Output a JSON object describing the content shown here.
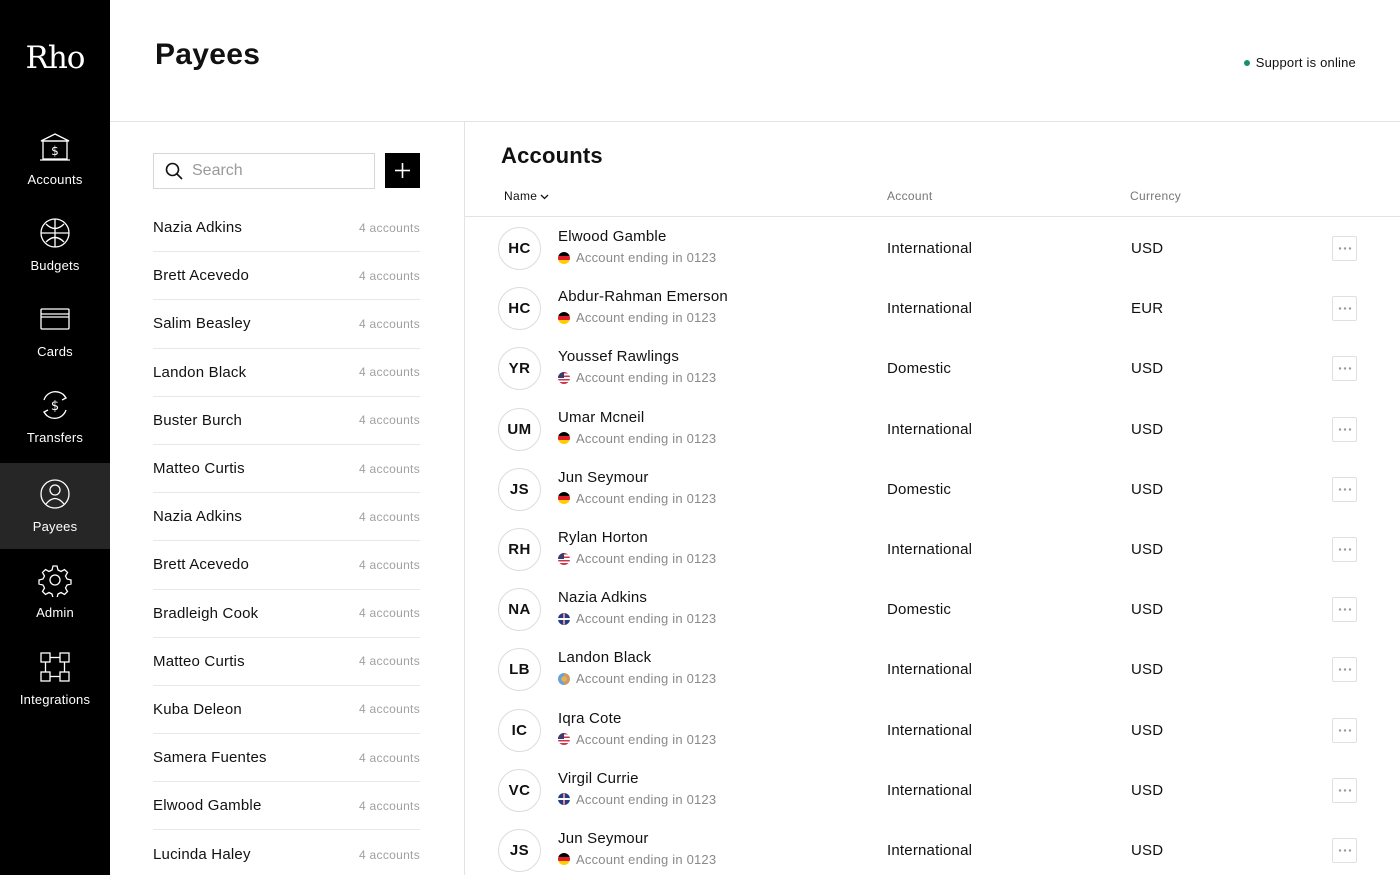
{
  "brand": {
    "logo": "Rho"
  },
  "nav": [
    {
      "label": "Accounts",
      "icon": "bank-icon"
    },
    {
      "label": "Budgets",
      "icon": "budgets-icon"
    },
    {
      "label": "Cards",
      "icon": "card-icon"
    },
    {
      "label": "Transfers",
      "icon": "dollar-cycle-icon"
    },
    {
      "label": "Payees",
      "icon": "user-icon",
      "active": true
    },
    {
      "label": "Admin",
      "icon": "gear-icon"
    },
    {
      "label": "Integrations",
      "icon": "integrations-icon"
    }
  ],
  "header": {
    "title": "Payees",
    "support_status": "Support is online",
    "status_color": "#1a8f6e"
  },
  "search": {
    "placeholder": "Search",
    "value": ""
  },
  "payees": [
    {
      "name": "Nazia Adkins",
      "count": "4 accounts"
    },
    {
      "name": "Brett Acevedo",
      "count": "4 accounts"
    },
    {
      "name": "Salim Beasley",
      "count": "4 accounts"
    },
    {
      "name": "Landon Black",
      "count": "4 accounts"
    },
    {
      "name": "Buster Burch",
      "count": "4 accounts"
    },
    {
      "name": "Matteo Curtis",
      "count": "4 accounts"
    },
    {
      "name": "Nazia Adkins",
      "count": "4 accounts"
    },
    {
      "name": "Brett Acevedo",
      "count": "4 accounts"
    },
    {
      "name": "Bradleigh Cook",
      "count": "4 accounts"
    },
    {
      "name": "Matteo Curtis",
      "count": "4 accounts"
    },
    {
      "name": "Kuba Deleon",
      "count": "4 accounts"
    },
    {
      "name": "Samera Fuentes",
      "count": "4 accounts"
    },
    {
      "name": "Elwood Gamble",
      "count": "4 accounts"
    },
    {
      "name": "Lucinda Haley",
      "count": "4 accounts"
    }
  ],
  "accounts": {
    "title": "Accounts",
    "columns": {
      "name": "Name",
      "account": "Account",
      "currency": "Currency"
    },
    "rows": [
      {
        "initials": "HC",
        "name": "Elwood Gamble",
        "sub": "Account ending in 0123",
        "flag": "de",
        "type": "International",
        "currency": "USD"
      },
      {
        "initials": "HC",
        "name": "Abdur-Rahman Emerson",
        "sub": "Account ending in 0123",
        "flag": "de",
        "type": "International",
        "currency": "EUR"
      },
      {
        "initials": "YR",
        "name": "Youssef Rawlings",
        "sub": "Account ending in 0123",
        "flag": "us",
        "type": "Domestic",
        "currency": "USD"
      },
      {
        "initials": "UM",
        "name": "Umar Mcneil",
        "sub": "Account ending in 0123",
        "flag": "de",
        "type": "International",
        "currency": "USD"
      },
      {
        "initials": "JS",
        "name": "Jun Seymour",
        "sub": "Account ending in 0123",
        "flag": "de",
        "type": "Domestic",
        "currency": "USD"
      },
      {
        "initials": "RH",
        "name": "Rylan Horton",
        "sub": "Account ending in 0123",
        "flag": "us",
        "type": "International",
        "currency": "USD"
      },
      {
        "initials": "NA",
        "name": "Nazia Adkins",
        "sub": "Account ending in 0123",
        "flag": "gb",
        "type": "Domestic",
        "currency": "USD"
      },
      {
        "initials": "LB",
        "name": "Landon Black",
        "sub": "Account ending in 0123",
        "flag": "mx",
        "type": "International",
        "currency": "USD"
      },
      {
        "initials": "IC",
        "name": "Iqra Cote",
        "sub": "Account ending in 0123",
        "flag": "us",
        "type": "International",
        "currency": "USD"
      },
      {
        "initials": "VC",
        "name": "Virgil Currie",
        "sub": "Account ending in 0123",
        "flag": "gb",
        "type": "International",
        "currency": "USD"
      },
      {
        "initials": "JS",
        "name": "Jun Seymour",
        "sub": "Account ending in 0123",
        "flag": "de",
        "type": "International",
        "currency": "USD"
      }
    ]
  }
}
